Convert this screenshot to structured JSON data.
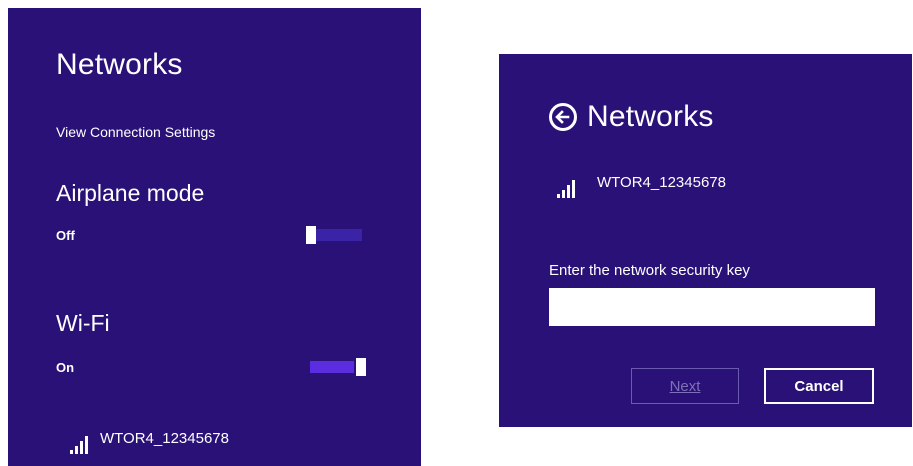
{
  "left": {
    "title": "Networks",
    "view_connection_settings": "View Connection Settings",
    "airplane_mode": {
      "label": "Airplane mode",
      "state": "Off",
      "on": false
    },
    "wifi": {
      "label": "Wi-Fi",
      "state": "On",
      "on": true
    },
    "network": {
      "ssid": "WTOR4_12345678",
      "icon": "wifi-signal-icon"
    }
  },
  "right": {
    "title": "Networks",
    "back_icon": "back-arrow-icon",
    "network": {
      "ssid": "WTOR4_12345678",
      "icon": "wifi-signal-icon"
    },
    "key_prompt": "Enter the network security key",
    "key_value": "",
    "next_label": "Next",
    "cancel_label": "Cancel"
  },
  "colors": {
    "panel_bg": "#2a1178",
    "accent": "#5a2ee0",
    "text": "#ffffff"
  }
}
